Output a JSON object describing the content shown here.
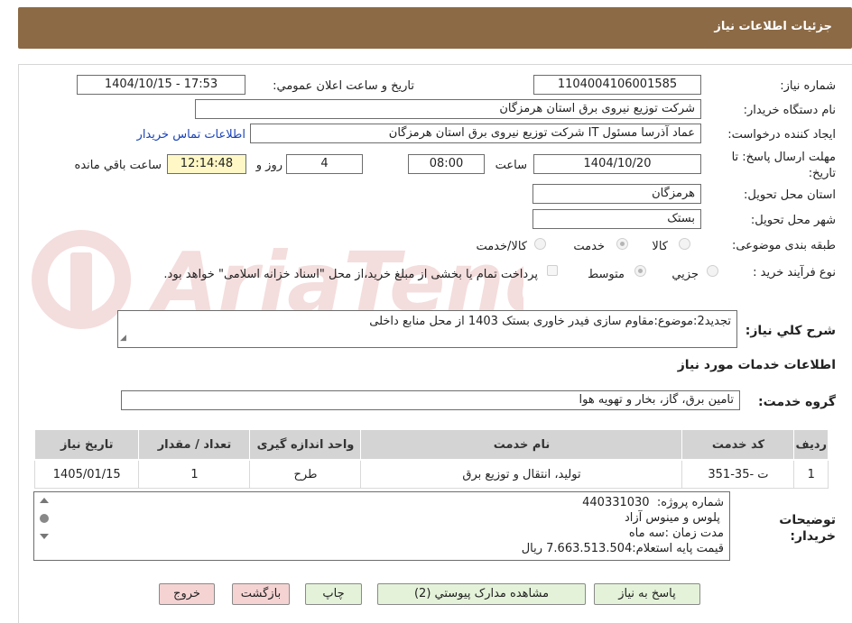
{
  "header": {
    "title": "جزئيات اطلاعات نياز"
  },
  "form": {
    "need_number_label": "شماره نياز:",
    "need_number": "1104004106001585",
    "announce_label": "تاريخ و ساعت اعلان عمومي:",
    "announce_value": "1404/10/15 - 17:53",
    "buyer_org_label": "نام دستگاه خريدار:",
    "buyer_org": "شرکت توزيع نيروی برق استان هرمزگان",
    "requester_label": "ايجاد کننده درخواست:",
    "requester": "عماد آذرسا مسئول IT شرکت توزيع نيروی برق استان هرمزگان",
    "contact_link": "اطلاعات تماس خريدار",
    "deadline_label": "مهلت ارسال پاسخ: تا تاريخ:",
    "deadline_date": "1404/10/20",
    "time_label": "ساعت",
    "deadline_time": "08:00",
    "days_value": "4",
    "days_label": "روز و",
    "remaining_time": "12:14:48",
    "remaining_label": "ساعت باقي مانده",
    "province_label": "استان محل تحويل:",
    "province": "هرمزگان",
    "city_label": "شهر محل تحويل:",
    "city": "بستک",
    "category_label": "طبقه بندی موضوعی:",
    "category_options": [
      "کالا",
      "خدمت",
      "کالا/خدمت"
    ],
    "category_selected": "خدمت",
    "process_label": "نوع فرآيند خريد :",
    "process_options": [
      "جزيي",
      "متوسط"
    ],
    "process_selected": "متوسط",
    "payment_note": "پرداخت تمام يا بخشی از مبلغ خريد،از محل \"اسناد خزانه اسلامی\" خواهد بود.",
    "summary_label": "شرح کلي نياز:",
    "summary": "تجديد2:موضوع:مقاوم سازی فيدر خاوری  بستک 1403 از محل منابع داخلی",
    "services_title": "اطلاعات خدمات مورد نياز",
    "service_group_label": "گروه خدمت:",
    "service_group": "تامين برق، گاز، بخار و تهويه هوا"
  },
  "table": {
    "headers": [
      "رديف",
      "کد خدمت",
      "نام خدمت",
      "واحد اندازه گيری",
      "تعداد / مقدار",
      "تاريخ نياز"
    ],
    "rows": [
      [
        "1",
        "ت -35-351",
        "توليد، انتقال و توزيع برق",
        "طرح",
        "1",
        "1405/01/15"
      ]
    ]
  },
  "buyer_notes": {
    "label": "توضيحات خريدار:",
    "lines": [
      "شماره پروژه:  440331030",
      " پلوس و مينوس آزاد",
      "مدت زمان :سه ماه",
      "قيمت پايه استعلام:7.663.513.504 ريال"
    ]
  },
  "buttons": {
    "reply": "پاسخ به نياز",
    "view_docs": "مشاهده مدارک پيوستي (2)",
    "print": "چاپ",
    "back": "بازگشت",
    "exit": "خروج"
  },
  "colors": {
    "header_bg": "#8c6a45",
    "green_btn": "#e4f2d9",
    "pink_btn": "#f5d3d3",
    "link": "#1a44b8"
  }
}
